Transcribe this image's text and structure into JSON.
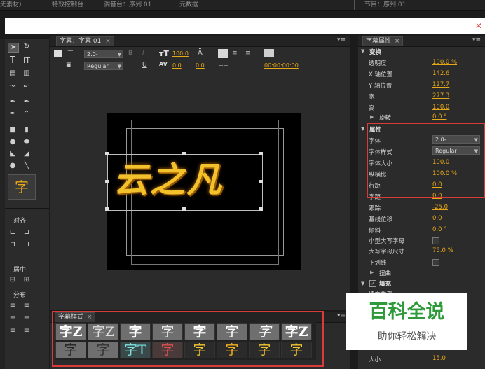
{
  "top_tabs": [
    "无素材）",
    "特效控制台",
    "调音台：序列 01",
    "元数据",
    "节目：序列 01"
  ],
  "titler": {
    "tab_label": "字幕：字幕 01",
    "font_value": "2.0-",
    "style_value": "Regular",
    "size_value": "100.0",
    "kerning_value": "0.0",
    "leading_value": "0.0",
    "timecode": "00:00:00:00",
    "canvas_text": "云之凡"
  },
  "tools_panel": {
    "align_label": "对齐",
    "center_label": "居中",
    "distribute_label": "分布"
  },
  "styles_panel": {
    "tab_label": "字幕样式",
    "row1": [
      "字Z",
      "字Z",
      "字",
      "字",
      "字",
      "字",
      "字",
      "字Z"
    ],
    "row2": [
      "字",
      "字",
      "字T",
      "字",
      "字",
      "字",
      "字",
      "字"
    ]
  },
  "props": {
    "tab_label": "字幕属性",
    "transform_label": "变换",
    "opacity_label": "透明度",
    "opacity_value": "100.0 %",
    "xpos_label": "X 轴位置",
    "xpos_value": "142.6",
    "ypos_label": "Y 轴位置",
    "ypos_value": "127.7",
    "width_label": "宽",
    "width_value": "277.3",
    "height_label": "高",
    "height_value": "100.0",
    "rotate_label": "旋转",
    "rotate_value": "0.0 °",
    "attr_label": "属性",
    "font_label": "字体",
    "font_value": "2.0-",
    "style_label": "字体样式",
    "style_value": "Regular",
    "size_label": "字体大小",
    "size_value": "100.0",
    "aspect_label": "纵横比",
    "aspect_value": "100.0 %",
    "leading_label": "行距",
    "leading_value": "0.0",
    "kerning_label": "字距",
    "kerning_value": "0.0",
    "tracking_label": "跟踪",
    "tracking_value": "-25.0",
    "baseline_label": "基线位移",
    "baseline_value": "0.0",
    "slant_label": "倾斜",
    "slant_value": "0.0 °",
    "smallcaps_label": "小型大写字母",
    "smallcaps_size_label": "大写字母尺寸",
    "smallcaps_size_value": "75.0 %",
    "underline_label": "下划线",
    "distort_label": "扭曲",
    "fill_label": "填充",
    "fill_type_label": "填充类型",
    "size2_label": "大小",
    "size2_value": "15.0"
  },
  "watermark": {
    "title": "百科全说",
    "subtitle": "助你轻松解决"
  },
  "colors": {
    "accent": "#e6a817",
    "highlight_box": "#d93a3a",
    "watermark_title": "#2f9a3a"
  }
}
